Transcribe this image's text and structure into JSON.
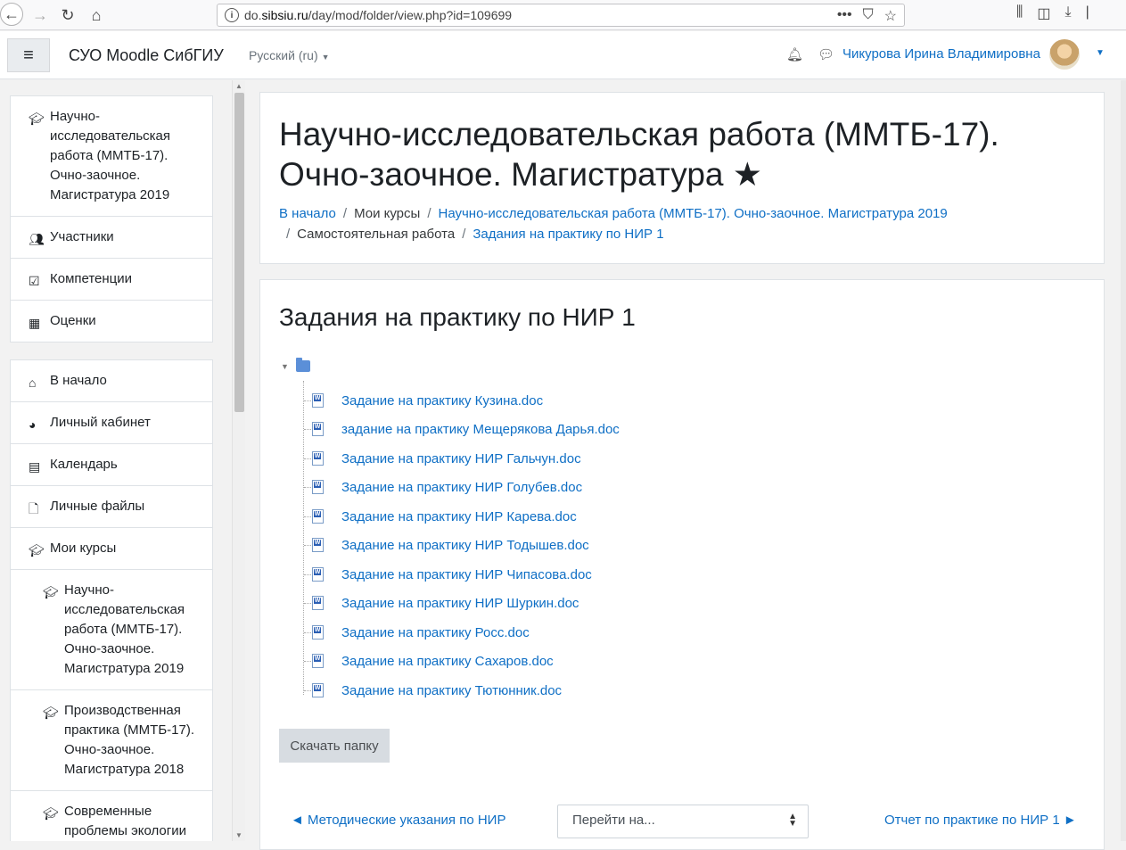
{
  "browser": {
    "url_prefix": "do.",
    "url_domain": "sibsiu.ru",
    "url_path": "/day/mod/folder/view.php?id=109699",
    "more_label": "•••"
  },
  "navbar": {
    "site_name": "СУО Moodle СибГИУ",
    "language": "Русский (ru)",
    "user_name": "Чикурова Ирина Владимировна"
  },
  "sidebar": {
    "course_block": [
      {
        "label": "Научно-исследовательская работа (ММТБ-17). Очно-заочное. Магистратура 2019",
        "icon": "graduation-cap-icon"
      },
      {
        "label": "Участники",
        "icon": "users-icon"
      },
      {
        "label": "Компетенции",
        "icon": "check-square-icon"
      },
      {
        "label": "Оценки",
        "icon": "table-icon"
      }
    ],
    "nav_block": [
      {
        "label": "В начало",
        "icon": "home-icon"
      },
      {
        "label": "Личный кабинет",
        "icon": "dashboard-icon"
      },
      {
        "label": "Календарь",
        "icon": "calendar-icon"
      },
      {
        "label": "Личные файлы",
        "icon": "file-icon"
      },
      {
        "label": "Мои курсы",
        "icon": "graduation-cap-icon"
      },
      {
        "label": "Научно-исследовательская работа (ММТБ-17). Очно-заочное. Магистратура 2019",
        "icon": "graduation-cap-icon"
      },
      {
        "label": "Производственная практика (ММТБ-17). Очно-заочное. Магистратура 2018",
        "icon": "graduation-cap-icon"
      },
      {
        "label": "Современные проблемы экологии",
        "icon": "graduation-cap-icon"
      }
    ]
  },
  "header": {
    "title": "Научно-исследовательская работа (ММТБ-17). Очно-заочное. Магистратура ★",
    "breadcrumb": {
      "home": "В начало",
      "my_courses": "Мои курсы",
      "course": "Научно-исследовательская работа (ММТБ-17). Очно-заочное. Магистратура 2019",
      "section": "Самостоятельная работа",
      "current": "Задания на практику по НИР 1"
    }
  },
  "folder": {
    "title": "Задания на практику по НИР 1",
    "files": [
      "Задание на практику Кузина.doc",
      "задание на практику Мещерякова Дарья.doc",
      "Задание на практику НИР Гальчун.doc",
      "Задание на практику НИР Голубев.doc",
      "Задание на практику НИР Карева.doc",
      "Задание на практику НИР Тодышев.doc",
      "Задание на практику НИР Чипасова.doc",
      "Задание на практику НИР Шуркин.doc",
      "Задание на практику Росс.doc",
      "Задание на практику Сахаров.doc",
      "Задание на практику Тютюнник.doc"
    ],
    "download_label": "Скачать папку"
  },
  "activity_nav": {
    "prev": "◄ Методические указания по НИР",
    "jump_placeholder": "Перейти на...",
    "next": "Отчет по практике по НИР 1 ►"
  }
}
